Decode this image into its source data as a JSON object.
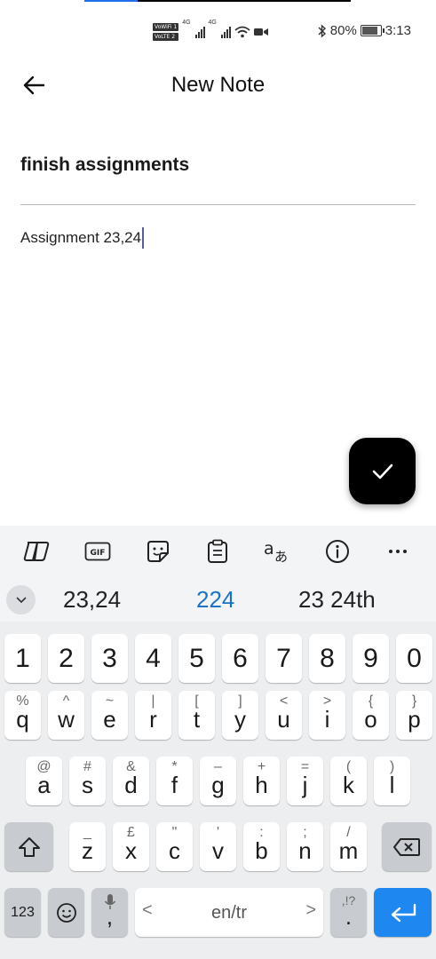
{
  "status_bar": {
    "sim1_label": "VoWiFi 1",
    "sim2_label": "VoLTE 2",
    "net1": "4G",
    "net2": "4G",
    "battery_percent": "80%",
    "time": "3:13"
  },
  "header": {
    "title": "New Note"
  },
  "note": {
    "title": "finish assignments",
    "body": "Assignment 23,24"
  },
  "keyboard": {
    "suggestions": [
      "23,24",
      "224",
      "23 24th"
    ],
    "number_row": [
      "1",
      "2",
      "3",
      "4",
      "5",
      "6",
      "7",
      "8",
      "9",
      "0"
    ],
    "row1": [
      {
        "main": "q",
        "hint": "%"
      },
      {
        "main": "w",
        "hint": "^"
      },
      {
        "main": "e",
        "hint": "~"
      },
      {
        "main": "r",
        "hint": "|"
      },
      {
        "main": "t",
        "hint": "["
      },
      {
        "main": "y",
        "hint": "]"
      },
      {
        "main": "u",
        "hint": "<"
      },
      {
        "main": "i",
        "hint": ">"
      },
      {
        "main": "o",
        "hint": "{"
      },
      {
        "main": "p",
        "hint": "}"
      }
    ],
    "row2": [
      {
        "main": "a",
        "hint": "@"
      },
      {
        "main": "s",
        "hint": "#"
      },
      {
        "main": "d",
        "hint": "&"
      },
      {
        "main": "f",
        "hint": "*"
      },
      {
        "main": "g",
        "hint": "–"
      },
      {
        "main": "h",
        "hint": "+"
      },
      {
        "main": "j",
        "hint": "="
      },
      {
        "main": "k",
        "hint": "("
      },
      {
        "main": "l",
        "hint": ")"
      }
    ],
    "row3": [
      {
        "main": "z",
        "hint": "_"
      },
      {
        "main": "x",
        "hint": "£"
      },
      {
        "main": "c",
        "hint": "\""
      },
      {
        "main": "v",
        "hint": "'"
      },
      {
        "main": "b",
        "hint": ":"
      },
      {
        "main": "n",
        "hint": ";"
      },
      {
        "main": "m",
        "hint": "/"
      }
    ],
    "bottom": {
      "symbols_label": "123",
      "comma": ",",
      "space_label": "en/tr",
      "space_left": "<",
      "space_right": ">",
      "period": ".",
      "period_hint": ",!?"
    }
  },
  "colors": {
    "accent": "#1e88f0",
    "suggestion_highlight": "#1a73c8",
    "fab": "#000000"
  }
}
